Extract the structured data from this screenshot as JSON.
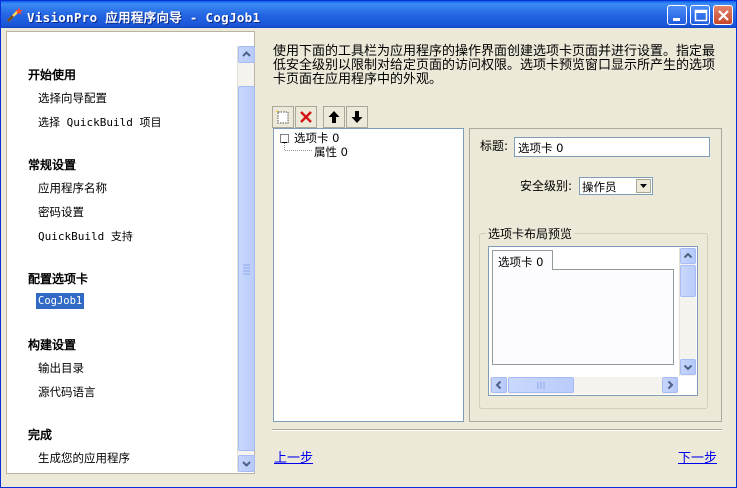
{
  "window": {
    "title": "VisionPro 应用程序向导 - CogJob1"
  },
  "nav": {
    "sections": [
      {
        "heading": "开始使用",
        "items": [
          "选择向导配置",
          "选择 QuickBuild 项目"
        ]
      },
      {
        "heading": "常规设置",
        "items": [
          "应用程序名称",
          "密码设置",
          "QuickBuild 支持"
        ]
      },
      {
        "heading": "配置选项卡",
        "items": [
          "CogJob1"
        ]
      },
      {
        "heading": "构建设置",
        "items": [
          "输出目录",
          "源代码语言"
        ]
      },
      {
        "heading": "完成",
        "items": [
          "生成您的应用程序"
        ]
      }
    ],
    "selected": "CogJob1"
  },
  "description": "使用下面的工具栏为应用程序的操作界面创建选项卡页面并进行设置。指定最低安全级别以限制对给定页面的访问权限。选项卡预览窗口显示所产生的选项卡页面在应用程序中的外观。",
  "toolbar": {
    "icons": [
      "new-tab-icon",
      "delete-icon",
      "move-up-icon",
      "move-down-icon"
    ]
  },
  "tree": {
    "root": "选项卡 0",
    "child": "属性 0"
  },
  "properties": {
    "title_label": "标题:",
    "title_value": "选项卡 0",
    "security_label": "安全级别:",
    "security_value": "操作员",
    "preview_group": "选项卡布局预览",
    "preview_tab": "选项卡 0"
  },
  "footer": {
    "back": "上一步",
    "next": "下一步"
  },
  "colors": {
    "titlebar": "#2466e3",
    "selection": "#316ac5",
    "link": "#0000ee",
    "face": "#ece9d8"
  }
}
